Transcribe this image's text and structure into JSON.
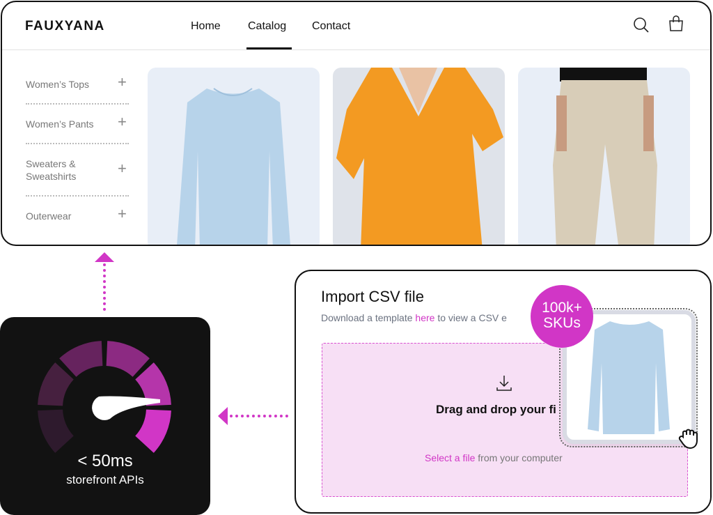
{
  "header": {
    "logo": "FAUXYANA",
    "nav": [
      {
        "label": "Home"
      },
      {
        "label": "Catalog",
        "active": true
      },
      {
        "label": "Contact"
      }
    ],
    "icons": [
      "search-icon",
      "shopping-bag-icon"
    ]
  },
  "sidebar": {
    "items": [
      {
        "label": "Women’s Tops"
      },
      {
        "label": "Women’s Pants"
      },
      {
        "label": "Sweaters & Sweatshirts"
      },
      {
        "label": "Outerwear"
      }
    ]
  },
  "products": [
    {
      "image": "light blue long-sleeve blouse"
    },
    {
      "image": "orange wrap dress"
    },
    {
      "image": "beige drawstring pants"
    }
  ],
  "speed": {
    "value": "< 50ms",
    "label": "storefront APIs",
    "gauge_colors": [
      "#2e1a2d",
      "#46203f",
      "#66235e",
      "#8c2a82",
      "#b535aa",
      "#d136c6"
    ]
  },
  "csv": {
    "title": "Import CSV file",
    "subtitle_pre": "Download a template ",
    "subtitle_link": "here",
    "subtitle_post": " to view a CSV e",
    "drop_text": "Drag and drop your fi",
    "select_link": "Select a file",
    "select_post": " from your computer",
    "badge_line1": "100k+",
    "badge_line2": "SKUs"
  },
  "colors": {
    "accent": "#d136c6",
    "dropzone": "#f7dff5",
    "dark": "#121212"
  }
}
